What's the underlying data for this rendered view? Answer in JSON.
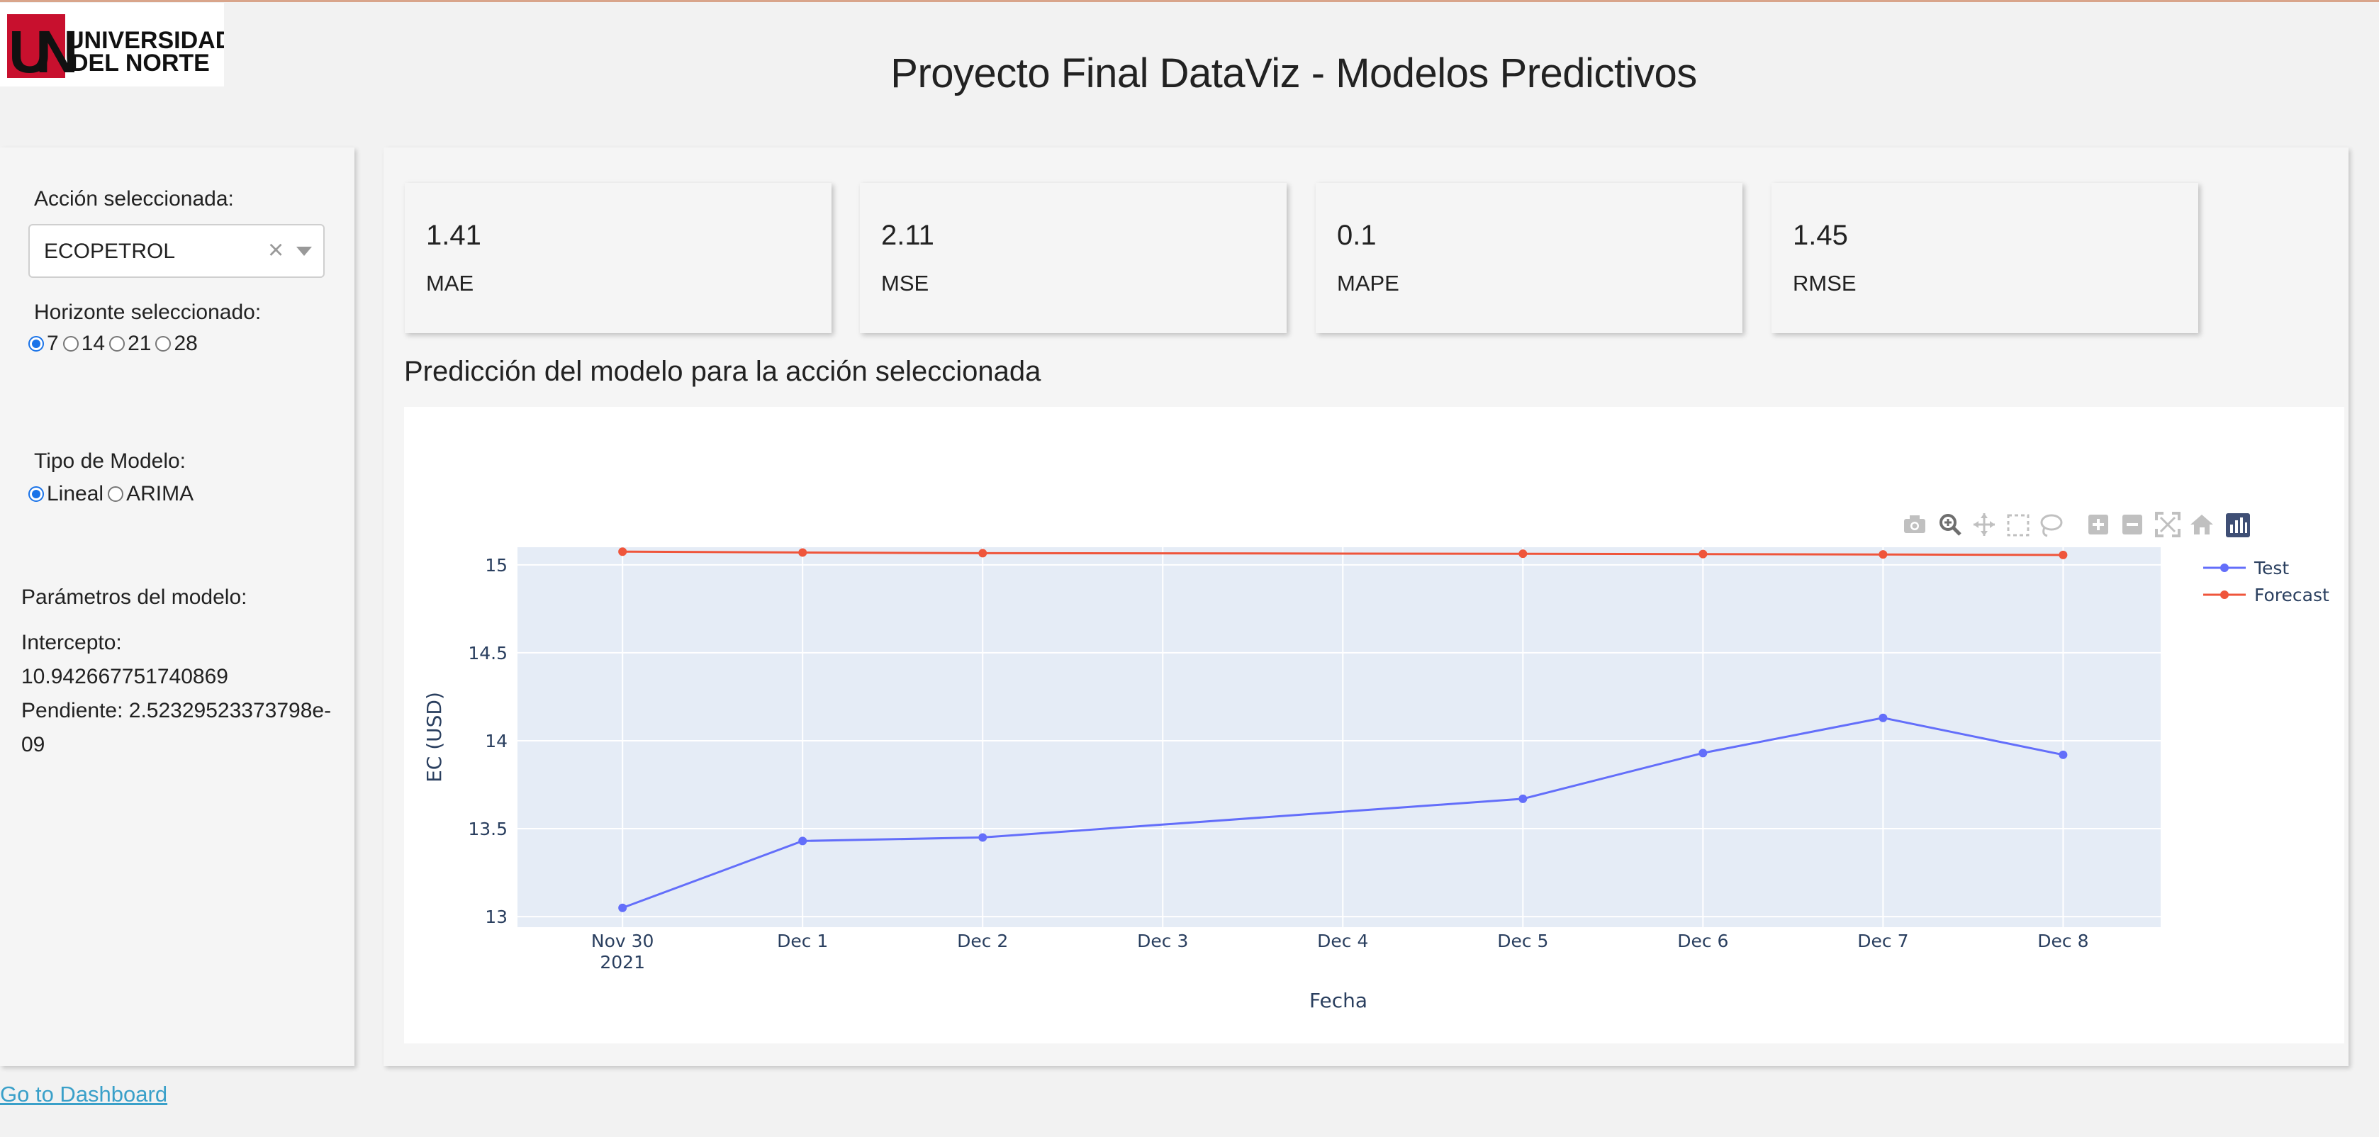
{
  "header": {
    "logo_text_line1": "UNIVERSIDAD",
    "logo_text_line2": "DEL NORTE",
    "title": "Proyecto Final DataViz - Modelos Predictivos"
  },
  "sidebar": {
    "action_label": "Acción seleccionada:",
    "action_value": "ECOPETROL",
    "horizon_label": "Horizonte seleccionado:",
    "horizon_options": [
      "7",
      "14",
      "21",
      "28"
    ],
    "horizon_selected": "7",
    "model_label": "Tipo de Modelo:",
    "model_options": [
      "Lineal",
      "ARIMA"
    ],
    "model_selected": "Lineal",
    "params_title": "Parámetros del modelo:",
    "intercept_label": "Intercepto:",
    "intercept_value": "10.942667751740869",
    "slope_line1": "Pendiente: 2.52329523373798e-",
    "slope_line2": "09"
  },
  "metrics": [
    {
      "value": "1.41",
      "name": "MAE"
    },
    {
      "value": "2.11",
      "name": "MSE"
    },
    {
      "value": "0.1",
      "name": "MAPE"
    },
    {
      "value": "1.45",
      "name": "RMSE"
    }
  ],
  "chart_section_title": "Predicción del modelo para la acción seleccionada",
  "modebar_icons": [
    "camera-icon",
    "zoom-icon",
    "pan-icon",
    "box-select-icon",
    "lasso-icon",
    "zoom-in-icon",
    "zoom-out-icon",
    "autoscale-icon",
    "home-icon",
    "plotly-logo-icon"
  ],
  "chart_data": {
    "type": "line",
    "xlabel": "Fecha",
    "ylabel": "EC (USD)",
    "x": [
      "2021-11-30",
      "2021-12-01",
      "2021-12-02",
      "2021-12-05",
      "2021-12-06",
      "2021-12-07",
      "2021-12-08"
    ],
    "x_ticks": [
      {
        "date": "2021-11-30",
        "label": "Nov 30",
        "sub": "2021"
      },
      {
        "date": "2021-12-01",
        "label": "Dec 1"
      },
      {
        "date": "2021-12-02",
        "label": "Dec 2"
      },
      {
        "date": "2021-12-03",
        "label": "Dec 3"
      },
      {
        "date": "2021-12-04",
        "label": "Dec 4"
      },
      {
        "date": "2021-12-05",
        "label": "Dec 5"
      },
      {
        "date": "2021-12-06",
        "label": "Dec 6"
      },
      {
        "date": "2021-12-07",
        "label": "Dec 7"
      },
      {
        "date": "2021-12-08",
        "label": "Dec 8"
      }
    ],
    "y_ticks": [
      13,
      13.5,
      14,
      14.5,
      15
    ],
    "ylim": [
      12.94,
      15.1
    ],
    "xlim": [
      "2021-11-29T10:00",
      "2021-12-08T13:00"
    ],
    "series": [
      {
        "name": "Test",
        "color": "#636efa",
        "values": [
          13.05,
          13.43,
          13.45,
          13.67,
          13.93,
          14.13,
          13.92
        ]
      },
      {
        "name": "Forecast",
        "color": "#ef553b",
        "values": [
          15.075,
          15.07,
          15.066,
          15.063,
          15.061,
          15.059,
          15.056
        ]
      }
    ],
    "legend": "top-right",
    "grid": true
  },
  "footer": {
    "link_text": "Go to Dashboard"
  }
}
